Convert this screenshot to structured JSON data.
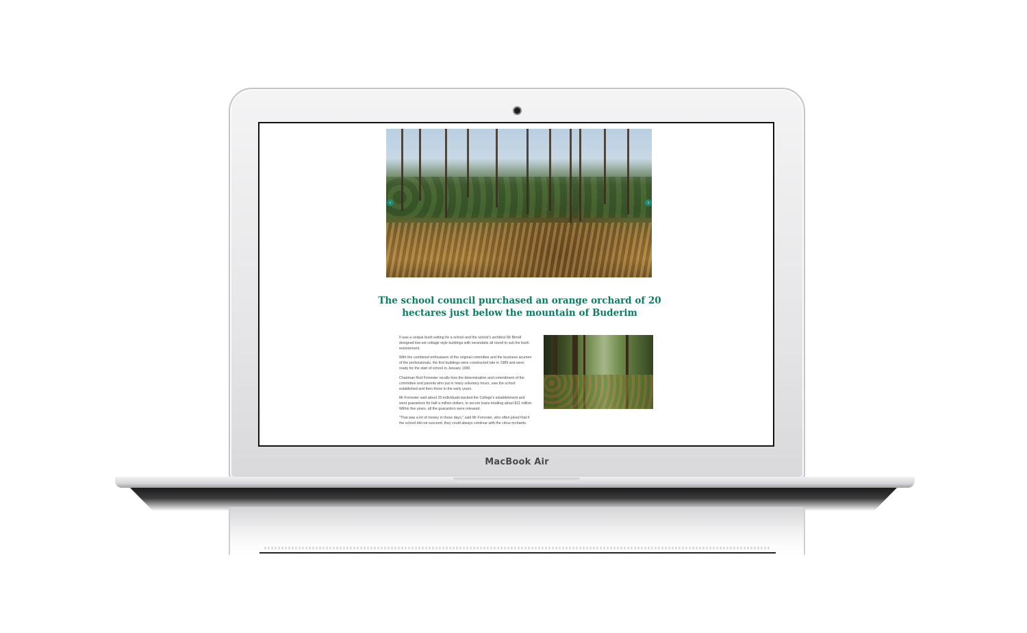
{
  "laptop": {
    "brand_label": "MacBook Air"
  },
  "page": {
    "hero": {
      "image_alt": "Cleared bushland with tall eucalyptus trees",
      "prev_arrow": "‹",
      "next_arrow": "›"
    },
    "headline": "The school council purchased an orange orchard of 20 hectares just below the mountain of Buderim",
    "paragraphs": [
      "It was a unique bush setting for a school and the school's architect Mr Birrell designed low-set cottage style buildings with verandahs all round to suit the bush environment.",
      "With the combined enthusiasm of the original committee and the business acumen of the professionals, the first buildings were constructed late in 1989 and were ready for the start of school in January 1990.",
      "Chairman Rod Forrester recalls how the determination and commitment of the committee and parents who put in many voluntary hours, saw the school established and then thrive in the early years.",
      "Mr Forrester said about 20 individuals backed the College's establishment and went guarantors for half a million dollars, to secure loans totalling about $11 million. Within five years, all the guarantors were released.",
      "\"That was a lot of money in those days,\" said Mr Forrester, who often joked that if the school did not succeed, they could always continue with the citrus orchards."
    ],
    "side_image_alt": "Dense bush with tree trunks",
    "accent_color": "#117a62"
  }
}
